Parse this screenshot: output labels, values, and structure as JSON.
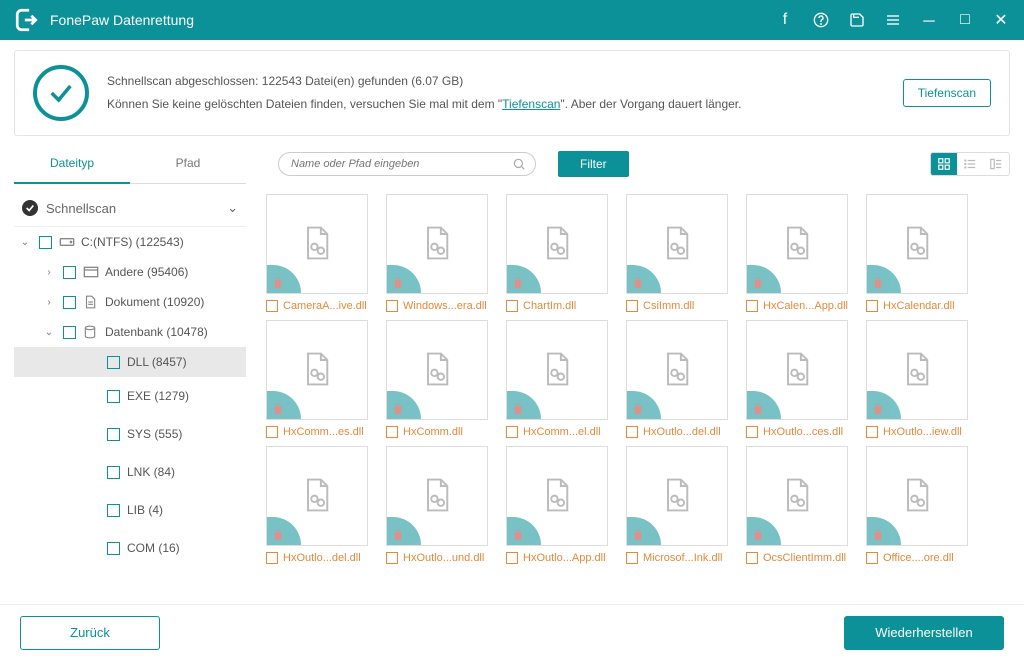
{
  "titlebar": {
    "title": "FonePaw Datenrettung"
  },
  "status": {
    "line1": "Schnellscan abgeschlossen: 122543 Datei(en) gefunden (6.07 GB)",
    "line2_a": "Können Sie keine gelöschten Dateien finden, versuchen Sie mal mit dem \"",
    "deepscan_link": "Tiefenscan",
    "line2_b": "\". Aber der Vorgang dauert länger.",
    "deepscan_button": "Tiefenscan"
  },
  "tabs": {
    "filetype": "Dateityp",
    "path": "Pfad"
  },
  "search": {
    "placeholder": "Name oder Pfad eingeben"
  },
  "filter": {
    "label": "Filter"
  },
  "sidebar": {
    "head": "Schnellscan",
    "items": [
      {
        "label": "C:(NTFS) (122543)"
      },
      {
        "label": "Andere (95406)"
      },
      {
        "label": "Dokument (10920)"
      },
      {
        "label": "Datenbank (10478)"
      },
      {
        "label": "DLL (8457)"
      },
      {
        "label": "EXE (1279)"
      },
      {
        "label": "SYS (555)"
      },
      {
        "label": "LNK (84)"
      },
      {
        "label": "LIB (4)"
      },
      {
        "label": "COM (16)"
      }
    ]
  },
  "files": [
    "CameraA...ive.dll",
    "Windows...era.dll",
    "ChartIm.dll",
    "CsiImm.dll",
    "HxCalen...App.dll",
    "HxCalendar.dll",
    "HxComm...es.dll",
    "HxComm.dll",
    "HxComm...el.dll",
    "HxOutlo...del.dll",
    "HxOutlo...ces.dll",
    "HxOutlo...iew.dll",
    "HxOutlo...del.dll",
    "HxOutlo...und.dll",
    "HxOutlo...App.dll",
    "Microsof...Ink.dll",
    "OcsClientImm.dll",
    "Office....ore.dll"
  ],
  "footer": {
    "back": "Zurück",
    "recover": "Wiederherstellen"
  }
}
